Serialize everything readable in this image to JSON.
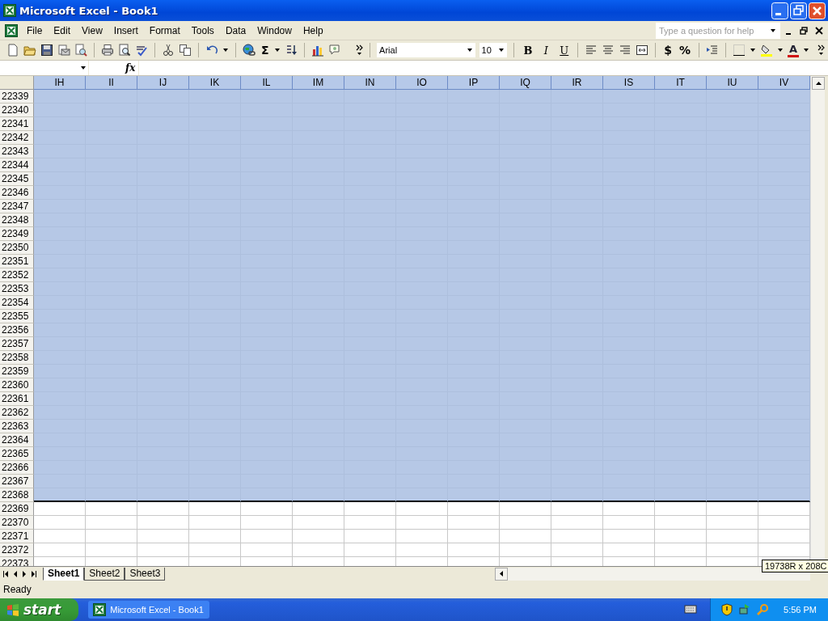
{
  "window": {
    "title": "Microsoft Excel - Book1"
  },
  "menu": [
    {
      "label": "File"
    },
    {
      "label": "Edit"
    },
    {
      "label": "View"
    },
    {
      "label": "Insert"
    },
    {
      "label": "Format"
    },
    {
      "label": "Tools"
    },
    {
      "label": "Data"
    },
    {
      "label": "Window"
    },
    {
      "label": "Help"
    }
  ],
  "help_box": {
    "placeholder": "Type a question for help"
  },
  "toolbar": {
    "sum_label": "Σ",
    "font": "Arial",
    "size": "10",
    "format_buttons": [
      "B",
      "I",
      "U"
    ],
    "number_buttons": [
      "$",
      "%"
    ],
    "font_color_label": "A"
  },
  "formula_bar": {
    "function_label": "fx"
  },
  "grid": {
    "columns": [
      {
        "label": "IH",
        "selected": true
      },
      {
        "label": "II",
        "selected": true
      },
      {
        "label": "IJ",
        "selected": true
      },
      {
        "label": "IK",
        "selected": true
      },
      {
        "label": "IL",
        "selected": true
      },
      {
        "label": "IM",
        "selected": true
      },
      {
        "label": "IN",
        "selected": true
      },
      {
        "label": "IO",
        "selected": true
      },
      {
        "label": "IP",
        "selected": true
      },
      {
        "label": "IQ",
        "selected": true
      },
      {
        "label": "IR",
        "selected": true
      },
      {
        "label": "IS",
        "selected": true
      },
      {
        "label": "IT",
        "selected": true
      },
      {
        "label": "IU",
        "selected": true
      },
      {
        "label": "IV",
        "selected": true
      }
    ],
    "rows": [
      {
        "number": "22339",
        "selected": true
      },
      {
        "number": "22340",
        "selected": true
      },
      {
        "number": "22341",
        "selected": true
      },
      {
        "number": "22342",
        "selected": true
      },
      {
        "number": "22343",
        "selected": true
      },
      {
        "number": "22344",
        "selected": true
      },
      {
        "number": "22345",
        "selected": true
      },
      {
        "number": "22346",
        "selected": true
      },
      {
        "number": "22347",
        "selected": true
      },
      {
        "number": "22348",
        "selected": true
      },
      {
        "number": "22349",
        "selected": true
      },
      {
        "number": "22350",
        "selected": true
      },
      {
        "number": "22351",
        "selected": true
      },
      {
        "number": "22352",
        "selected": true
      },
      {
        "number": "22353",
        "selected": true
      },
      {
        "number": "22354",
        "selected": true
      },
      {
        "number": "22355",
        "selected": true
      },
      {
        "number": "22356",
        "selected": true
      },
      {
        "number": "22357",
        "selected": true
      },
      {
        "number": "22358",
        "selected": true
      },
      {
        "number": "22359",
        "selected": true
      },
      {
        "number": "22360",
        "selected": true
      },
      {
        "number": "22361",
        "selected": true
      },
      {
        "number": "22362",
        "selected": true
      },
      {
        "number": "22363",
        "selected": true
      },
      {
        "number": "22364",
        "selected": true
      },
      {
        "number": "22365",
        "selected": true
      },
      {
        "number": "22366",
        "selected": true
      },
      {
        "number": "22367",
        "selected": true
      },
      {
        "number": "22368",
        "selected": true
      },
      {
        "number": "22369",
        "selected": false
      },
      {
        "number": "22370",
        "selected": false
      },
      {
        "number": "22371",
        "selected": false
      },
      {
        "number": "22372",
        "selected": false
      },
      {
        "number": "22373",
        "selected": false
      }
    ]
  },
  "sheet_tabs": [
    {
      "label": "Sheet1",
      "selected": true
    },
    {
      "label": "Sheet2",
      "selected": false
    },
    {
      "label": "Sheet3",
      "selected": false
    }
  ],
  "tooltip": "19738R x 208C",
  "status_bar": {
    "text": "Ready"
  },
  "taskbar": {
    "start": "start",
    "tasks": [
      {
        "label": "Microsoft Excel - Book1",
        "selected": false
      }
    ],
    "clock": "5:56 PM"
  }
}
